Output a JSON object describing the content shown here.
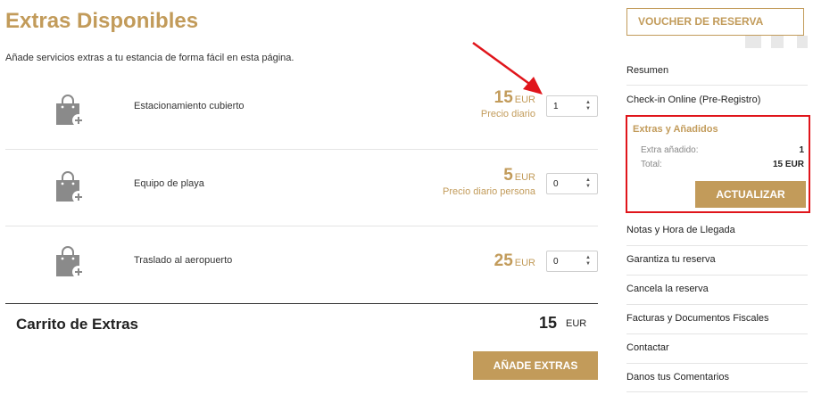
{
  "header": {
    "title": "Extras Disponibles",
    "subtitle": "Añade servicios extras a tu estancia de forma fácil en esta página."
  },
  "extras": [
    {
      "name": "Estacionamiento cubierto",
      "price": "15",
      "currency": "EUR",
      "note": "Precio diario",
      "quantity": "1",
      "icon": "shopping-bag-add-icon"
    },
    {
      "name": "Equipo de playa",
      "price": "5",
      "currency": "EUR",
      "note": "Precio diario persona",
      "quantity": "0",
      "icon": "shopping-bag-add-icon"
    },
    {
      "name": "Traslado al aeropuerto",
      "price": "25",
      "currency": "EUR",
      "note": "",
      "quantity": "0",
      "icon": "shopping-bag-add-icon"
    }
  ],
  "cart": {
    "title": "Carrito de Extras",
    "amount": "15",
    "currency": "EUR",
    "add_button": "AÑADE EXTRAS"
  },
  "sidebar": {
    "voucher_button": "VOUCHER DE RESERVA",
    "links_top": [
      "Resumen",
      "Check-in Online (Pre-Registro)"
    ],
    "extras_panel": {
      "title": "Extras y Añadidos",
      "extra_label": "Extra añadido:",
      "extra_value": "1",
      "total_label": "Total:",
      "total_value": "15 EUR",
      "update_button": "ACTUALIZAR"
    },
    "links_bottom": [
      "Notas y Hora de Llegada",
      "Garantiza tu reserva",
      "Cancela la reserva",
      "Facturas y Documentos Fiscales",
      "Contactar",
      "Danos tus Comentarios"
    ]
  },
  "colors": {
    "accent": "#c29b5a",
    "annotation": "#e0151b"
  }
}
